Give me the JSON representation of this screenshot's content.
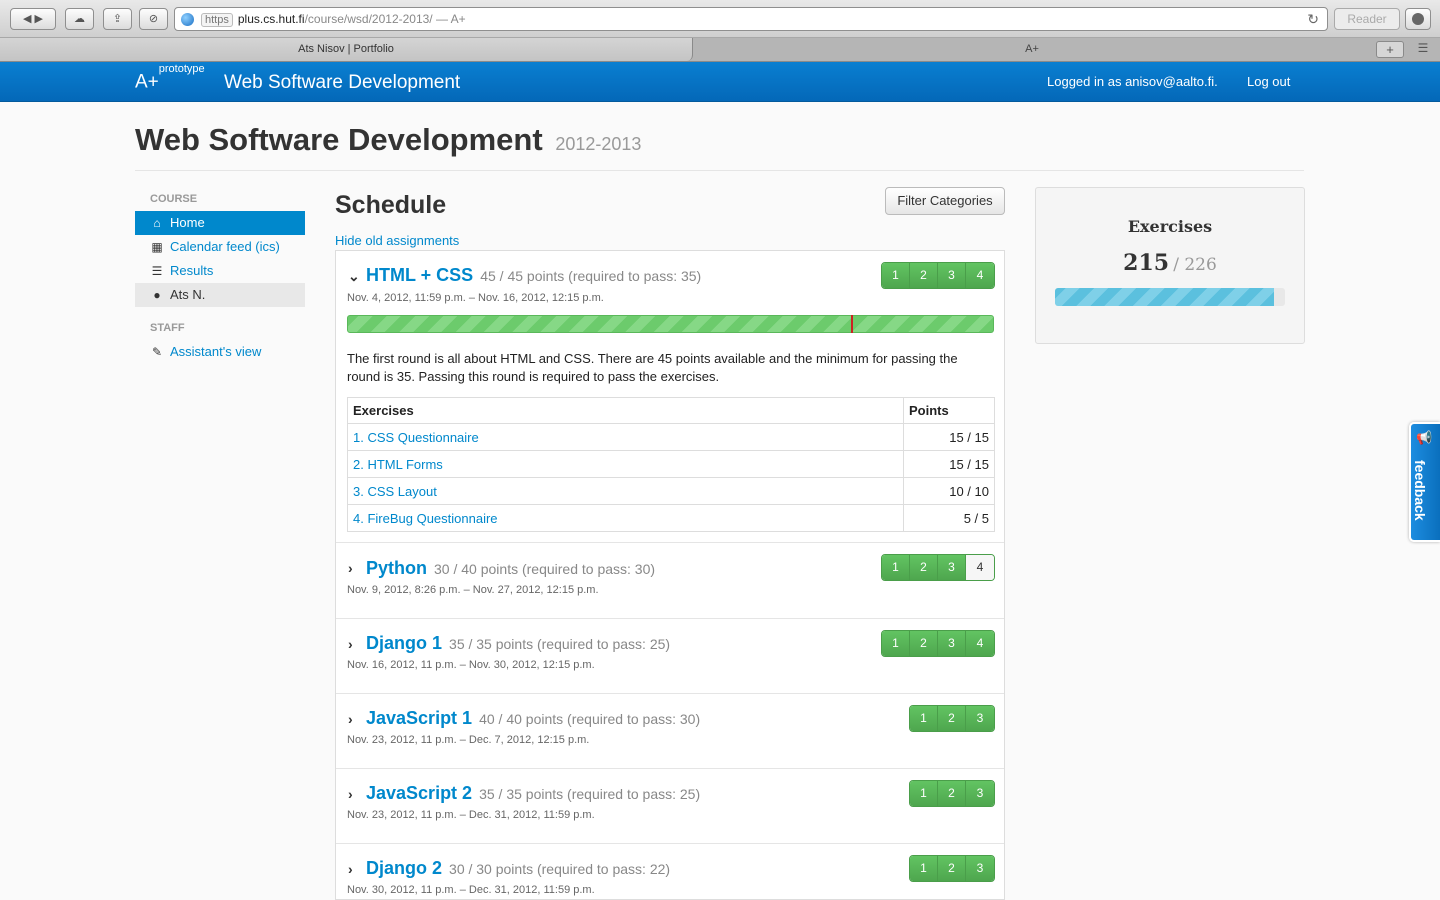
{
  "browser": {
    "https": "https",
    "url_host": "plus.cs.hut.fi",
    "url_path": "/course/wsd/2012-2013/",
    "url_title": "— A+",
    "reader": "Reader",
    "tabs": [
      {
        "label": "Ats Nisov | Portfolio"
      },
      {
        "label": "A+"
      }
    ]
  },
  "navbar": {
    "brand": "A+",
    "brand_sup": "prototype",
    "course": "Web Software Development",
    "logged_in": "Logged in as anisov@aalto.fi.",
    "logout": "Log out"
  },
  "page": {
    "title": "Web Software Development",
    "year": "2012-2013"
  },
  "sidebar": {
    "course_header": "COURSE",
    "items": [
      {
        "label": "Home",
        "icon": "home-icon"
      },
      {
        "label": "Calendar feed (ics)",
        "icon": "calendar-icon"
      },
      {
        "label": "Results",
        "icon": "list-icon"
      },
      {
        "label": "Ats N.",
        "icon": "user-icon"
      }
    ],
    "staff_header": "STAFF",
    "staff_items": [
      {
        "label": "Assistant's view",
        "icon": "pencil-icon"
      }
    ]
  },
  "schedule": {
    "title": "Schedule",
    "filter": "Filter Categories",
    "hide_old": "Hide old assignments",
    "rounds": [
      {
        "name": "HTML + CSS",
        "points": "45 / 45 points (required to pass: 35)",
        "dates": "Nov. 4, 2012, 11:59 p.m. – Nov. 16, 2012, 12:15 p.m.",
        "badges": [
          "1",
          "2",
          "3",
          "4"
        ],
        "expanded": true,
        "progress": 1.0,
        "pass_fraction": 0.7778,
        "description": "The first round is all about HTML and CSS. There are 45 points available and the minimum for passing the round is 35. Passing this round is required to pass the exercises.",
        "table": {
          "col_exercises": "Exercises",
          "col_points": "Points",
          "rows": [
            {
              "name": "1. CSS Questionnaire",
              "points": "15 / 15"
            },
            {
              "name": "2. HTML Forms",
              "points": "15 / 15"
            },
            {
              "name": "3. CSS Layout",
              "points": "10 / 10"
            },
            {
              "name": "4. FireBug Questionnaire",
              "points": "5 / 5"
            }
          ]
        }
      },
      {
        "name": "Python",
        "points": "30 / 40 points (required to pass: 30)",
        "dates": "Nov. 9, 2012, 8:26 p.m. – Nov. 27, 2012, 12:15 p.m.",
        "badges": [
          "1",
          "2",
          "3",
          "4"
        ],
        "completed_badges": 3
      },
      {
        "name": "Django 1",
        "points": "35 / 35 points (required to pass: 25)",
        "dates": "Nov. 16, 2012, 11 p.m. – Nov. 30, 2012, 12:15 p.m.",
        "badges": [
          "1",
          "2",
          "3",
          "4"
        ]
      },
      {
        "name": "JavaScript 1",
        "points": "40 / 40 points (required to pass: 30)",
        "dates": "Nov. 23, 2012, 11 p.m. – Dec. 7, 2012, 12:15 p.m.",
        "badges": [
          "1",
          "2",
          "3"
        ]
      },
      {
        "name": "JavaScript 2",
        "points": "35 / 35 points (required to pass: 25)",
        "dates": "Nov. 23, 2012, 11 p.m. – Dec. 31, 2012, 11:59 p.m.",
        "badges": [
          "1",
          "2",
          "3"
        ]
      },
      {
        "name": "Django 2",
        "points": "30 / 30 points (required to pass: 22)",
        "dates": "Nov. 30, 2012, 11 p.m. – Dec. 31, 2012, 11:59 p.m.",
        "badges": [
          "1",
          "2",
          "3"
        ]
      }
    ]
  },
  "exercises_panel": {
    "title": "Exercises",
    "score": "215",
    "max": "/ 226",
    "progress": 0.951
  },
  "feedback": {
    "label": "feedback",
    "icon": "megaphone-icon"
  }
}
